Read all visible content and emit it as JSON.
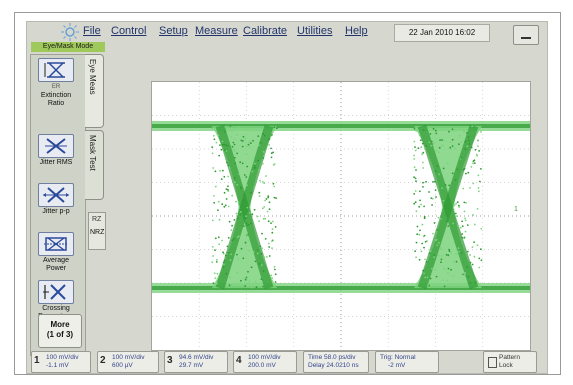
{
  "menu": [
    "File",
    "Control",
    "Setup",
    "Measure",
    "Calibrate",
    "Utilities",
    "Help"
  ],
  "datetime": "22 Jan 2010  16:02",
  "mode_tab": "Eye/Mask Mode",
  "side_tabs": {
    "eye_meas": "Eye Meas",
    "mask_test": "Mask Test"
  },
  "measure_buttons": [
    {
      "label": "Extinction Ratio",
      "icon": "extinction-ratio-icon"
    },
    {
      "label": "Jitter RMS",
      "icon": "jitter-rms-icon"
    },
    {
      "label": "Jitter p-p",
      "icon": "jitter-pp-icon"
    },
    {
      "label": "Average Power",
      "icon": "average-power-icon"
    },
    {
      "label": "Crossing Percentage",
      "icon": "crossing-percentage-icon"
    }
  ],
  "ext_ratio_badge": "ER",
  "nrz": {
    "top": "RZ",
    "bottom": "NRZ"
  },
  "more_button": {
    "line1": "More",
    "line2": "(1 of 3)"
  },
  "channels": [
    {
      "num": "1",
      "scale": "100 mV/div",
      "offset": "-1.1 mV"
    },
    {
      "num": "2",
      "scale": "100 mV/div",
      "offset": "600 µV"
    },
    {
      "num": "3",
      "scale": "94.6 mV/div",
      "offset": "29.7 mV"
    },
    {
      "num": "4",
      "scale": "100 mV/div",
      "offset": "200.0 mV"
    }
  ],
  "timebase": {
    "time": "Time 58.0 ps/div",
    "delay": "Delay 24.0210 ns"
  },
  "trigger": {
    "line1": "Trig: Normal",
    "line2": "-2 mV"
  },
  "pattern_lock": {
    "line1": "Pattern",
    "line2": "Lock"
  },
  "trigger_marker": "1",
  "colors": {
    "trace": "#2e9a32",
    "trace_light": "#7cd27e",
    "menu_text": "#22336b",
    "panel": "#d6d8cf"
  }
}
